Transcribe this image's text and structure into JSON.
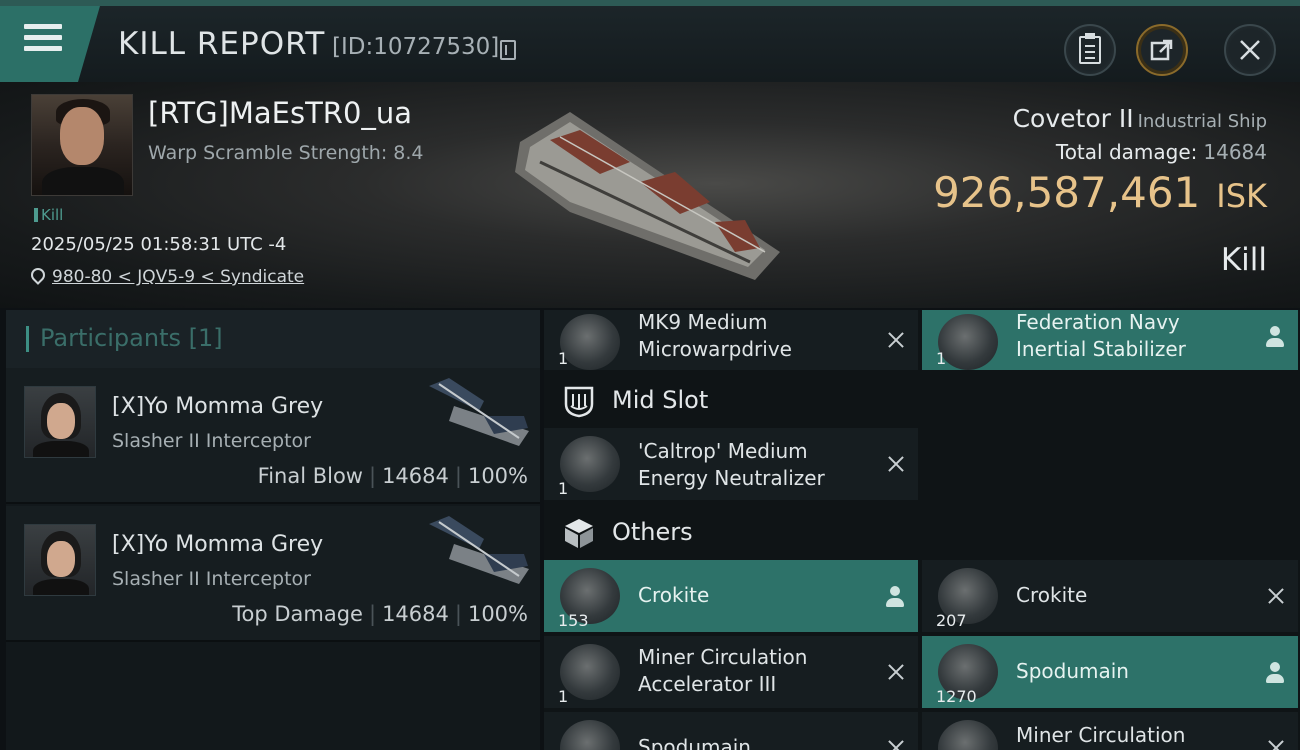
{
  "header": {
    "title": "KILL REPORT",
    "report_id": "[ID:10727530]"
  },
  "victim": {
    "name": "[RTG]MaEsTR0_ua",
    "warp_scramble": "Warp Scramble Strength: 8.4",
    "tag": "Kill",
    "datetime": "2025/05/25 01:58:31 UTC -4",
    "location": "980-80 < JQV5-9 < Syndicate",
    "ship_name": "Covetor II",
    "ship_class": "Industrial Ship",
    "total_damage_label": "Total damage:",
    "total_damage": "14684",
    "isk_value": "926,587,461",
    "isk_unit": "ISK",
    "result": "Kill"
  },
  "participants": {
    "label": "Participants",
    "count": "[1]",
    "rows": [
      {
        "name": "[X]Yo Momma Grey",
        "ship": "Slasher II Interceptor",
        "role": "Final Blow",
        "damage": "14684",
        "percent": "100%"
      },
      {
        "name": "[X]Yo Momma Grey",
        "ship": "Slasher II Interceptor",
        "role": "Top Damage",
        "damage": "14684",
        "percent": "100%"
      }
    ]
  },
  "fitting": {
    "top_items": [
      {
        "line1": "MK9 Medium",
        "line2": "Microwarpdrive",
        "qty": "1",
        "status": "destroyed"
      },
      {
        "line1": "Federation Navy",
        "line2": "Inertial Stabilizer",
        "qty": "1",
        "status": "dropped"
      }
    ],
    "mid_slot_label": "Mid Slot",
    "mid_items": [
      {
        "line1": "'Caltrop' Medium",
        "line2": "Energy Neutralizer",
        "qty": "1",
        "status": "destroyed"
      }
    ],
    "others_label": "Others",
    "other_items": [
      {
        "line1": "Crokite",
        "line2": "",
        "qty": "153",
        "status": "dropped"
      },
      {
        "line1": "Crokite",
        "line2": "",
        "qty": "207",
        "status": "destroyed"
      },
      {
        "line1": "Miner Circulation",
        "line2": "Accelerator III",
        "qty": "1",
        "status": "destroyed"
      },
      {
        "line1": "Spodumain",
        "line2": "",
        "qty": "1270",
        "status": "dropped"
      },
      {
        "line1": "Spodumain",
        "line2": "",
        "qty": "",
        "status": "destroyed"
      },
      {
        "line1": "Miner Circulation",
        "line2": "",
        "qty": "",
        "status": "destroyed"
      }
    ]
  },
  "colors": {
    "accent_teal": "#2d7269",
    "isk_gold": "#e7c38a",
    "panel_dark": "#161d20"
  }
}
